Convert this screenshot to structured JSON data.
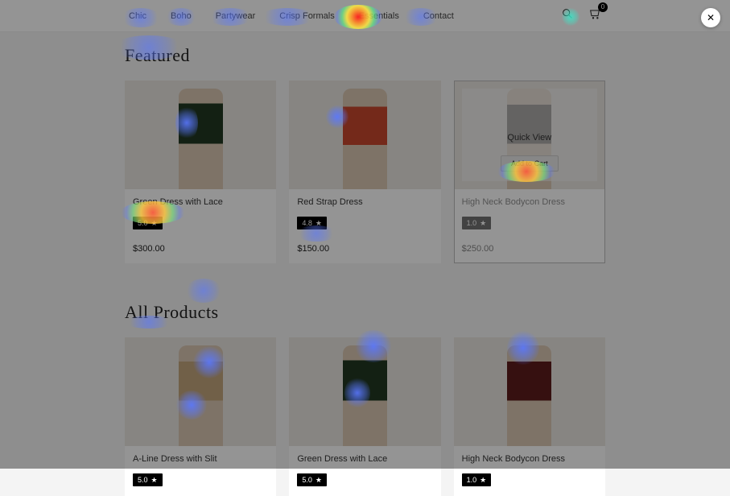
{
  "nav": {
    "items": [
      "Chic",
      "Boho",
      "Partywear",
      "Crisp Formals",
      "Essentials",
      "Contact"
    ],
    "cart_count": "0"
  },
  "sections": {
    "featured_title": "Featured",
    "all_title": "All Products"
  },
  "featured": [
    {
      "title": "Green Dress with Lace",
      "rating": "5.0",
      "price": "$300.00",
      "palette": "green"
    },
    {
      "title": "Red Strap Dress",
      "rating": "4.8",
      "price": "$150.00",
      "palette": "red"
    },
    {
      "title": "High Neck Bodycon Dress",
      "rating": "1.0",
      "price": "$250.00",
      "palette": "grey",
      "hover": {
        "quick_view": "Quick View",
        "add_to_cart": "Add to Cart"
      }
    }
  ],
  "all": [
    {
      "title": "A-Line Dress with Slit",
      "rating": "5.0",
      "palette": "tan"
    },
    {
      "title": "Green Dress with Lace",
      "rating": "5.0",
      "palette": "green"
    },
    {
      "title": "High Neck Bodycon Dress",
      "rating": "1.0",
      "palette": "maroon"
    }
  ],
  "close_label": "✕",
  "star": "★"
}
